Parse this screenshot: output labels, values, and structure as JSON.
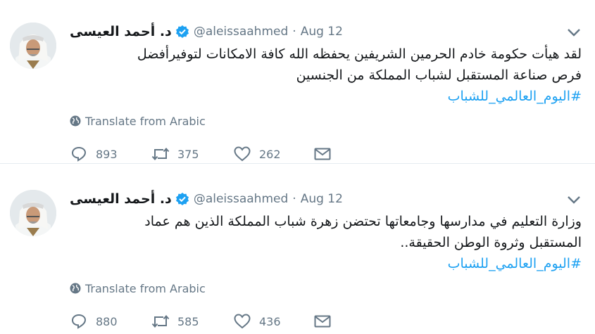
{
  "tweets": [
    {
      "author_name": "د. أحمد العيسى",
      "handle": "@aleissaahmed",
      "separator": "·",
      "date": "Aug 12",
      "text_lines": [
        "لقد هيأت حكومة خادم الحرمين الشريفين يحفظه الله كافة الامكانات لتوفيرأفضل",
        "فرص صناعة المستقبل لشباب المملكة من الجنسين"
      ],
      "hashtag": "#اليوم_العالمي_للشباب",
      "translate_label": "Translate from Arabic",
      "replies": "893",
      "retweets": "375",
      "likes": "262"
    },
    {
      "author_name": "د. أحمد العيسى",
      "handle": "@aleissaahmed",
      "separator": "·",
      "date": "Aug 12",
      "text_lines": [
        "وزارة التعليم في مدارسها وجامعاتها تحتضن زهرة شباب المملكة الذين هم عماد",
        "المستقبل وثروة الوطن الحقيقة.."
      ],
      "hashtag": "#اليوم_العالمي_للشباب",
      "translate_label": "Translate from Arabic",
      "replies": "880",
      "retweets": "585",
      "likes": "436"
    }
  ],
  "icons": {
    "verified": "verified-badge-icon",
    "caret": "chevron-down-icon",
    "globe": "globe-icon",
    "reply": "reply-icon",
    "retweet": "retweet-icon",
    "like": "heart-icon",
    "dm": "envelope-icon"
  },
  "colors": {
    "accent": "#1da1f2",
    "muted": "#657786",
    "text": "#14171a",
    "divider": "#e6ecf0"
  }
}
